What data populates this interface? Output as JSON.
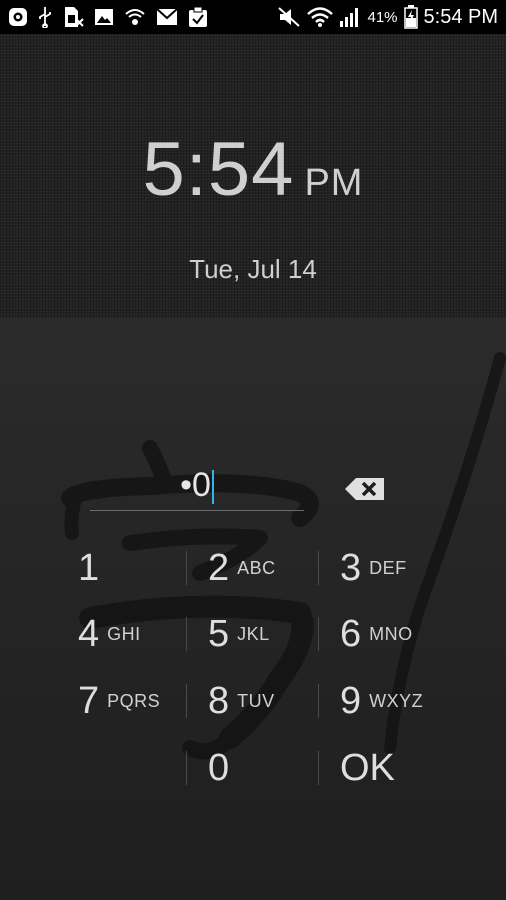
{
  "status_bar": {
    "icons_left": [
      "chat-app-icon",
      "usb-icon",
      "sim-card-icon",
      "image-icon",
      "vpn-shield-icon",
      "gmail-icon",
      "clipboard-check-icon"
    ],
    "icons_right": [
      "mute-icon",
      "wifi-icon",
      "signal-icon",
      "battery-icon"
    ],
    "battery_percent": "41%",
    "time": "5:54 PM"
  },
  "lock_clock": {
    "time": "5:54",
    "ampm": "PM",
    "date": "Tue, Jul 14"
  },
  "pin_entry": {
    "value": "•0"
  },
  "keypad": {
    "keys": [
      {
        "digit": "1",
        "letters": ""
      },
      {
        "digit": "2",
        "letters": "ABC"
      },
      {
        "digit": "3",
        "letters": "DEF"
      },
      {
        "digit": "4",
        "letters": "GHI"
      },
      {
        "digit": "5",
        "letters": "JKL"
      },
      {
        "digit": "6",
        "letters": "MNO"
      },
      {
        "digit": "7",
        "letters": "PQRS"
      },
      {
        "digit": "8",
        "letters": "TUV"
      },
      {
        "digit": "9",
        "letters": "WXYZ"
      },
      {
        "digit": "0",
        "letters": ""
      },
      {
        "digit": "OK",
        "letters": ""
      }
    ]
  },
  "colors": {
    "accent_cursor": "#33b5e5",
    "text": "#d8d8d8"
  }
}
